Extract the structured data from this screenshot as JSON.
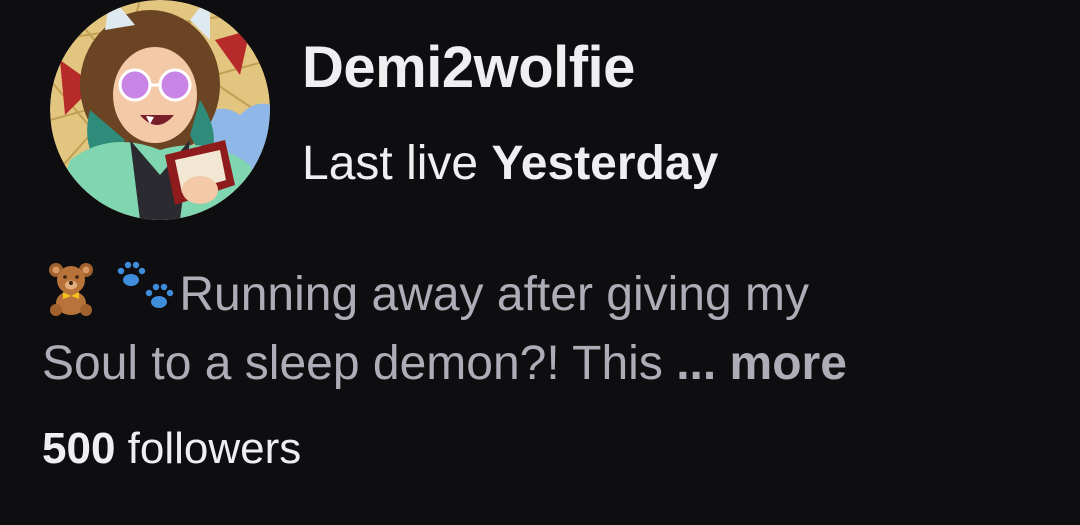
{
  "channel": {
    "name": "Demi2wolfie",
    "last_live_label": "Last live",
    "last_live_value": "Yesterday",
    "avatar_icon": "illustrated-avatar"
  },
  "bio": {
    "emoji_1": "teddy-bear-icon",
    "emoji_2": "paw-prints-icon",
    "line_1": "Running away after giving my",
    "line_2": "Soul to a sleep demon?! This",
    "ellipsis": "...",
    "more_label": "more"
  },
  "followers": {
    "count": "500",
    "label": "followers"
  },
  "colors": {
    "background": "#0e0e10",
    "primary_text": "#efeff1",
    "secondary_text": "#adadb8",
    "paw_blue": "#3f8ddb"
  }
}
